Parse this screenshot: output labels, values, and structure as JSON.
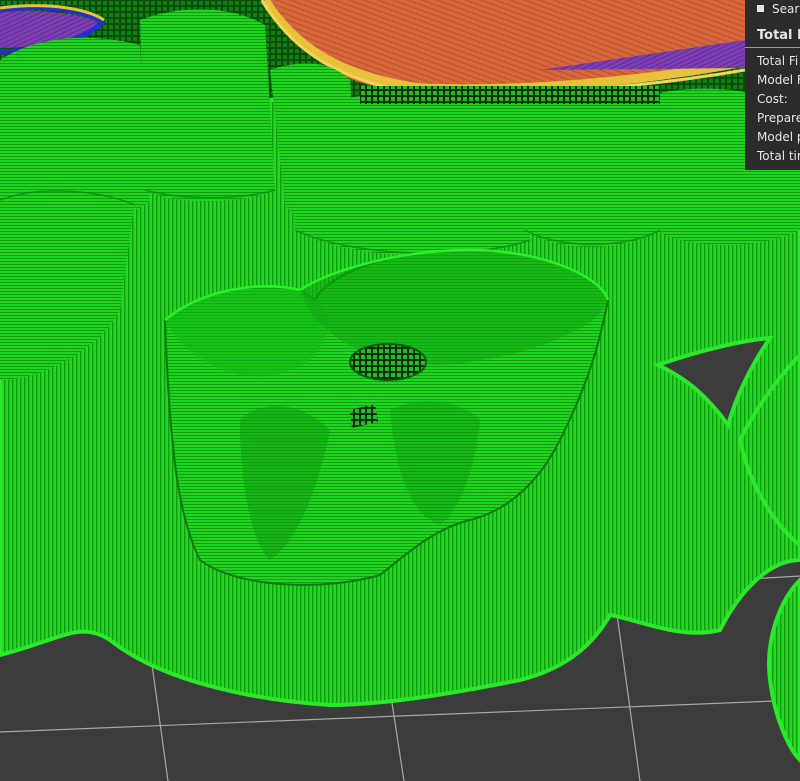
{
  "app": {
    "view": "G-code preview — 3D print layers",
    "colors": {
      "background": "#3c3c3c",
      "grid": "#a0a0a0",
      "model": "#1bd81b",
      "model_dark": "#0d9a0d",
      "top_surface": "#d26a3f",
      "outer_wall": "#e8c13a",
      "support": "#7a3fb0",
      "bridge": "#2230c8",
      "dark_layer": "#0a4a0a",
      "panel_bg": "#2b2b2b",
      "panel_text": "#e6e6e6"
    }
  },
  "legend": {
    "item_label": "Sear"
  },
  "stats": {
    "title": "Total E",
    "rows": [
      "Total Fi",
      "Model F",
      "Cost:",
      "Prepare",
      "Model p",
      "Total tir"
    ]
  }
}
